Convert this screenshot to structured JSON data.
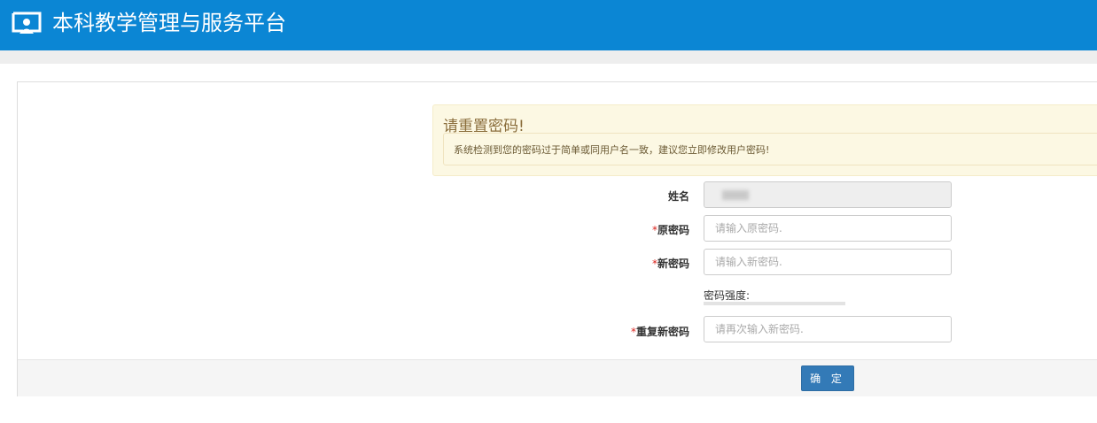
{
  "header": {
    "title": "本科教学管理与服务平台",
    "logo_icon": "monitor-user-icon",
    "bg_color": "#0b86d4"
  },
  "alert": {
    "title": "请重置密码!",
    "message": "系统检测到您的密码过于简单或同用户名一致，建议您立即修改用户密码!"
  },
  "form": {
    "required_mark": "*",
    "name_label": "姓名",
    "old_password_label": "原密码",
    "old_password_placeholder": "请输入原密码.",
    "new_password_label": "新密码",
    "new_password_placeholder": "请输入新密码.",
    "strength_label": "密码强度:",
    "strength_level": 0,
    "repeat_password_label": "重复新密码",
    "repeat_password_placeholder": "请再次输入新密码."
  },
  "footer": {
    "confirm_label": "确 定",
    "button_color": "#337ab7"
  }
}
